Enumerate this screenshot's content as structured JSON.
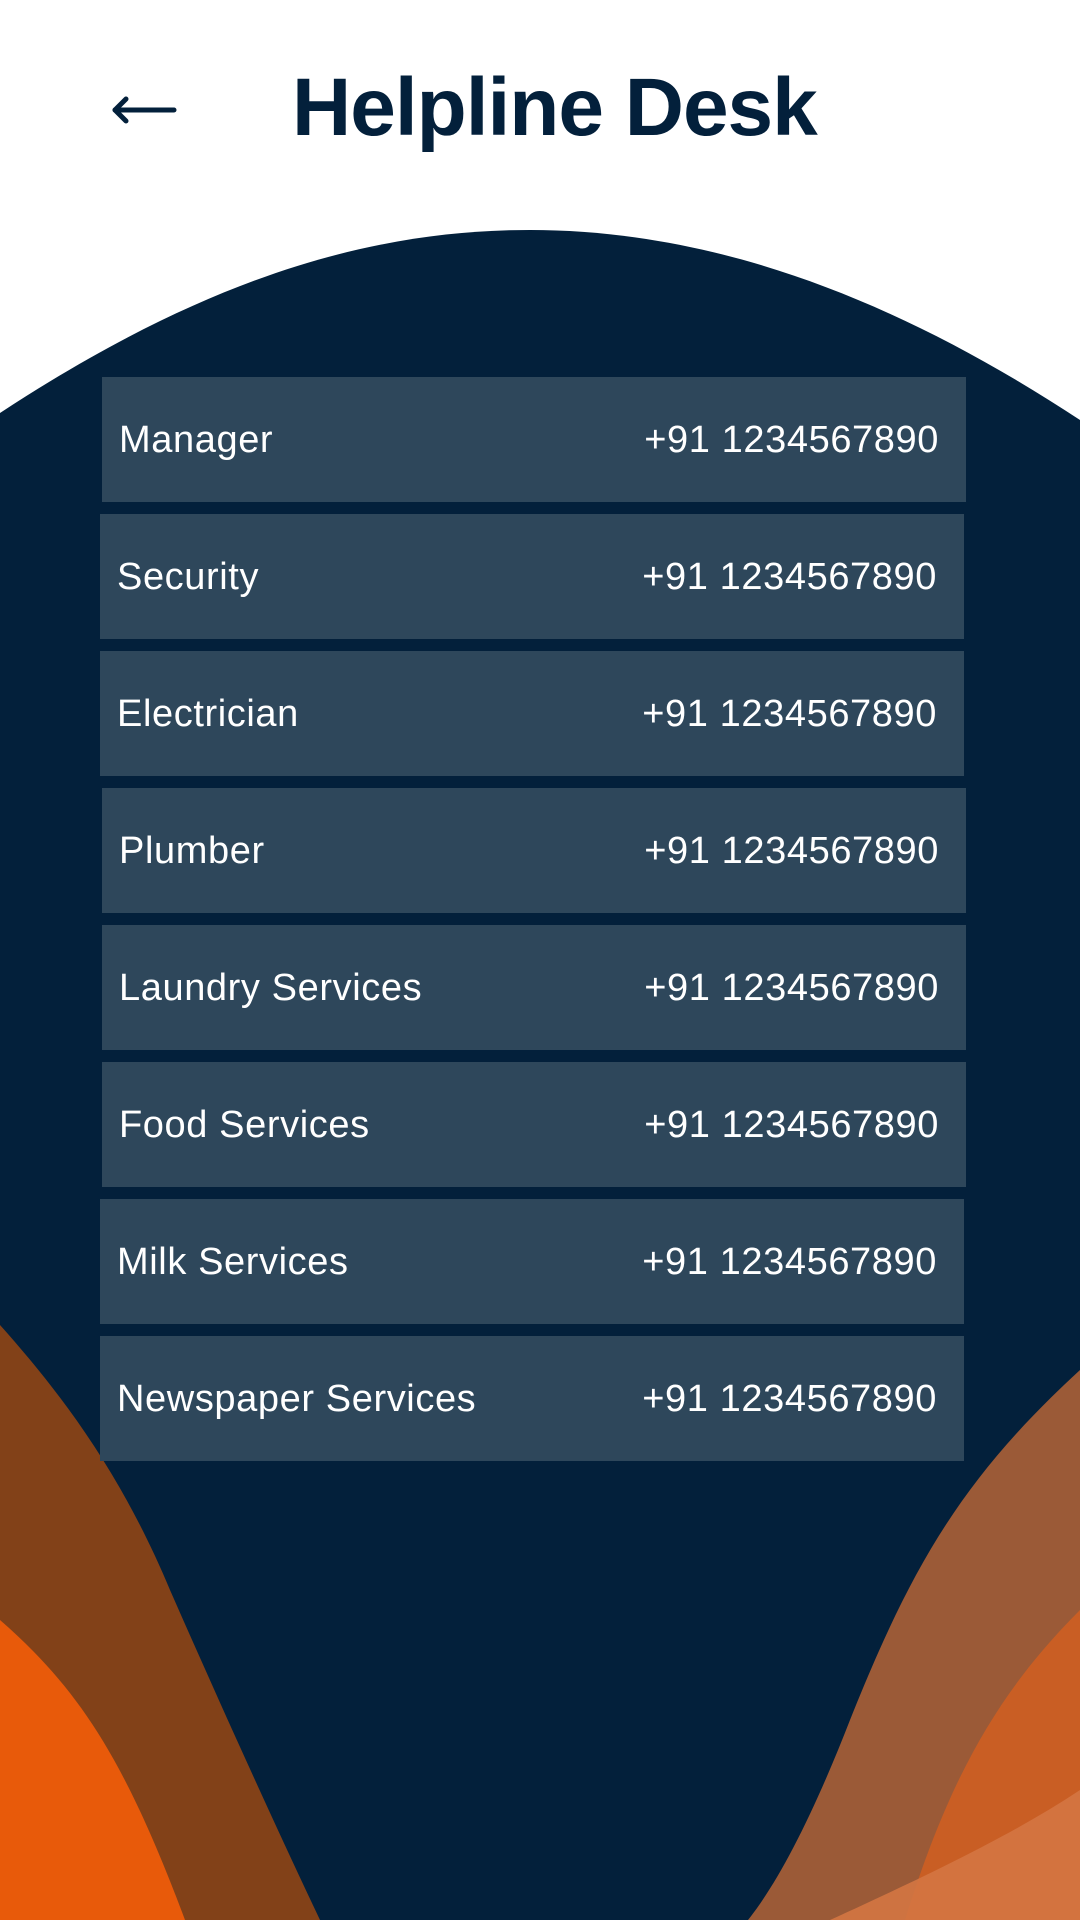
{
  "header": {
    "title": "Helpline Desk",
    "back_icon": "back-arrow-icon"
  },
  "contacts": [
    {
      "name": "Manager",
      "phone": "+91 1234567890"
    },
    {
      "name": "Security",
      "phone": "+91 1234567890"
    },
    {
      "name": "Electrician",
      "phone": "+91 1234567890"
    },
    {
      "name": "Plumber",
      "phone": "+91 1234567890"
    },
    {
      "name": "Laundry Services",
      "phone": "+91 1234567890"
    },
    {
      "name": "Food Services",
      "phone": "+91 1234567890"
    },
    {
      "name": "Milk Services",
      "phone": "+91 1234567890"
    },
    {
      "name": "Newspaper Services",
      "phone": "+91 1234567890"
    }
  ],
  "colors": {
    "navy": "#03203b",
    "row": "#2e475b",
    "text": "#ffffff",
    "orange": "#e85a0a",
    "brown": "#824118",
    "rust": "#9b5a37"
  }
}
